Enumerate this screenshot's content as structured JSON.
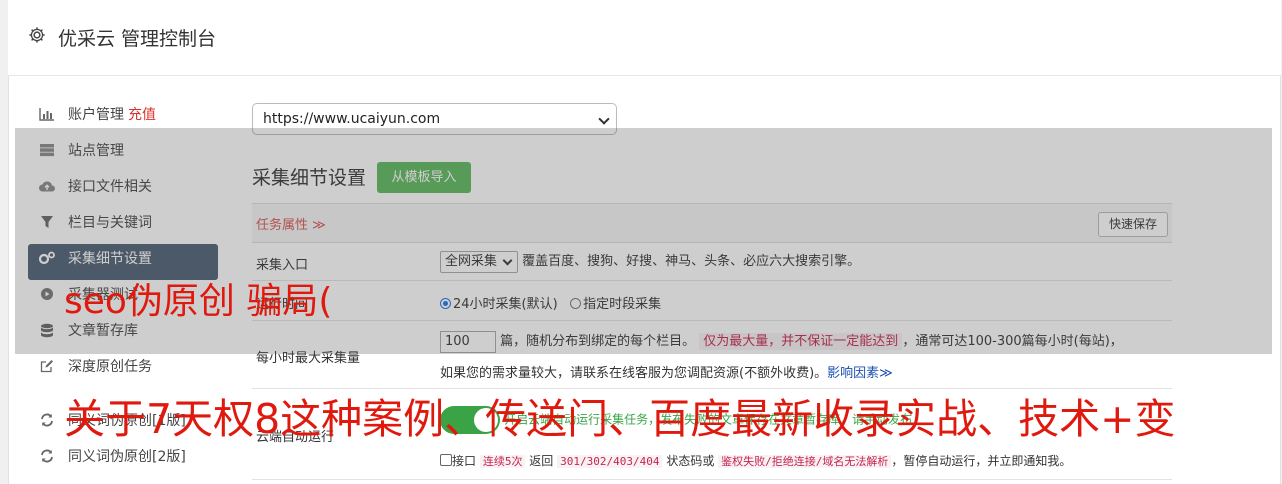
{
  "header": {
    "title": "优采云 管理控制台"
  },
  "sidebar": {
    "items": [
      {
        "label": "账户管理",
        "extra": "充值",
        "icon": "bar-chart-icon"
      },
      {
        "label": "站点管理",
        "icon": "server-icon"
      },
      {
        "label": "接口文件相关",
        "icon": "cloud-upload-icon"
      },
      {
        "label": "栏目与关键词",
        "icon": "filter-icon"
      },
      {
        "label": "采集细节设置",
        "icon": "gears-icon",
        "active": true
      },
      {
        "label": "采集器测试",
        "icon": "play-circle-icon"
      },
      {
        "label": "文章暂存库",
        "icon": "database-icon"
      },
      {
        "label": "深度原创任务",
        "icon": "edit-icon"
      },
      {
        "label": "同义词伪原创[1版]",
        "icon": "refresh-icon"
      },
      {
        "label": "同义词伪原创[2版]",
        "icon": "refresh-icon"
      }
    ]
  },
  "main": {
    "site_select_value": "https://www.ucaiyun.com",
    "section_title": "采集细节设置",
    "import_button": "从模板导入",
    "task_attr_label": "任务属性 ≫",
    "quick_save": "快速保存",
    "rows": {
      "entry": {
        "label": "采集入口",
        "select_value": "全网采集",
        "desc": "覆盖百度、搜狗、好搜、神马、头条、必应六大搜索引擎。"
      },
      "run_time": {
        "label": "运行时间",
        "opt1": "24小时采集(默认)",
        "opt2": "指定时段采集"
      },
      "max_per_hour": {
        "label": "每小时最大采集量",
        "value": "100",
        "t1": "篇，随机分布到绑定的每个栏目。",
        "warn": "仅为最大量，并不保证一定能达到",
        "t2": "，通常可达100-300篇每小时(每站)，",
        "t3": "如果您的需求量较大，请联系在线客服为您调配资源(不额外收费)。",
        "link": "影响因素≫"
      },
      "cloud_run": {
        "label": "云端自动运行",
        "toggle_text": "开启云端自动运行采集任务，发布失败的文章保存在文章暂存库，请手动发布",
        "check_label": "接口",
        "c1": "连续5次",
        "c2": "返回",
        "c3": "301/302/403/404",
        "c4": "状态码或",
        "c5": "鉴权失败/拒绝连接/域名无法解析",
        "c6": "，暂停自动运行，并立即通知我。"
      }
    }
  },
  "overlay_text": {
    "line1": "seo伪原创 骗局(",
    "line2": "关于7天权8这种案例、传送门、百度最新收录实战、技术+变"
  },
  "colors": {
    "accent_green": "#5cb85c",
    "active_nav": "#4b5e72",
    "overlay_red": "#e0190e"
  }
}
